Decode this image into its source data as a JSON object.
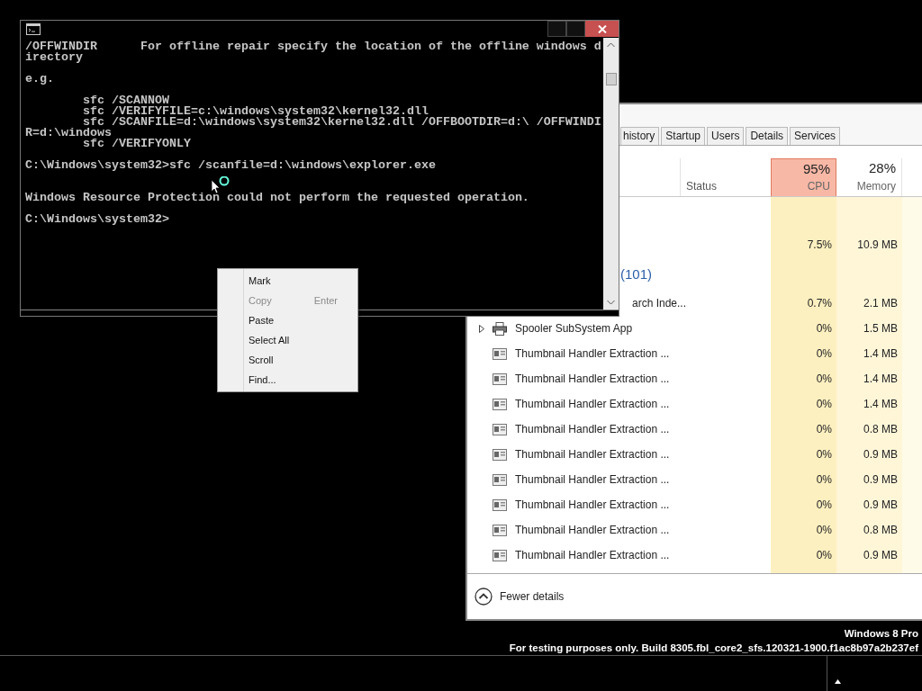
{
  "console_window": {
    "output": "/OFFWINDIR      For offline repair specify the location of the offline windows d\nirectory\n\ne.g.\n\n        sfc /SCANNOW\n        sfc /VERIFYFILE=c:\\windows\\system32\\kernel32.dll\n        sfc /SCANFILE=d:\\windows\\system32\\kernel32.dll /OFFBOOTDIR=d:\\ /OFFWINDI\nR=d:\\windows\n        sfc /VERIFYONLY\n\nC:\\Windows\\system32>sfc /scanfile=d:\\windows\\explorer.exe\n\n\nWindows Resource Protection could not perform the requested operation.\n\nC:\\Windows\\system32>",
    "context_menu": [
      {
        "label": "Mark",
        "disabled": false
      },
      {
        "label": "Copy",
        "shortcut": "Enter",
        "disabled": true
      },
      {
        "label": "Paste",
        "disabled": false
      },
      {
        "label": "Select All",
        "disabled": false
      },
      {
        "label": "Scroll",
        "disabled": false
      },
      {
        "label": "Find...",
        "disabled": false
      }
    ]
  },
  "task_manager": {
    "tabs": [
      {
        "label": "history",
        "selected": false
      },
      {
        "label": "Startup",
        "selected": false
      },
      {
        "label": "Users",
        "selected": false
      },
      {
        "label": "Details",
        "selected": false
      },
      {
        "label": "Services",
        "selected": false
      }
    ],
    "columns": [
      {
        "kind": "status",
        "label": "Status"
      },
      {
        "kind": "cpu",
        "reading": "95%",
        "label": "CPU",
        "alert": true
      },
      {
        "kind": "memory",
        "reading": "28%",
        "label": "Memory",
        "alert": false
      }
    ],
    "rows": [
      {
        "kind": "covered",
        "cpu": "7.5%",
        "memory": "10.9 MB"
      },
      {
        "kind": "heading",
        "name": "(101)"
      },
      {
        "kind": "covered",
        "name": "arch Inde...",
        "cpu": "0.7%",
        "memory": "2.1 MB"
      },
      {
        "kind": "service",
        "name": "Spooler SubSystem App",
        "cpu": "0%",
        "memory": "1.5 MB",
        "expandable": true
      },
      {
        "kind": "process",
        "name": "Thumbnail Handler Extraction ...",
        "cpu": "0%",
        "memory": "1.4 MB",
        "expandable": false
      },
      {
        "kind": "process",
        "name": "Thumbnail Handler Extraction ...",
        "cpu": "0%",
        "memory": "1.4 MB",
        "expandable": false
      },
      {
        "kind": "process",
        "name": "Thumbnail Handler Extraction ...",
        "cpu": "0%",
        "memory": "1.4 MB",
        "expandable": false
      },
      {
        "kind": "process",
        "name": "Thumbnail Handler Extraction ...",
        "cpu": "0%",
        "memory": "0.8 MB",
        "expandable": false
      },
      {
        "kind": "process",
        "name": "Thumbnail Handler Extraction ...",
        "cpu": "0%",
        "memory": "0.9 MB",
        "expandable": false
      },
      {
        "kind": "process",
        "name": "Thumbnail Handler Extraction ...",
        "cpu": "0%",
        "memory": "0.9 MB",
        "expandable": false
      },
      {
        "kind": "process",
        "name": "Thumbnail Handler Extraction ...",
        "cpu": "0%",
        "memory": "0.9 MB",
        "expandable": false
      },
      {
        "kind": "process",
        "name": "Thumbnail Handler Extraction ...",
        "cpu": "0%",
        "memory": "0.8 MB",
        "expandable": false
      },
      {
        "kind": "process",
        "name": "Thumbnail Handler Extraction ...",
        "cpu": "0%",
        "memory": "0.9 MB",
        "expandable": false
      }
    ],
    "footer": "Fewer details"
  },
  "desktop": {
    "edition": "Windows 8 Pro",
    "build": "For testing purposes only. Build 8305.fbl_core2_sfs.120321-1900.f1ac8b97a2b237ef"
  }
}
